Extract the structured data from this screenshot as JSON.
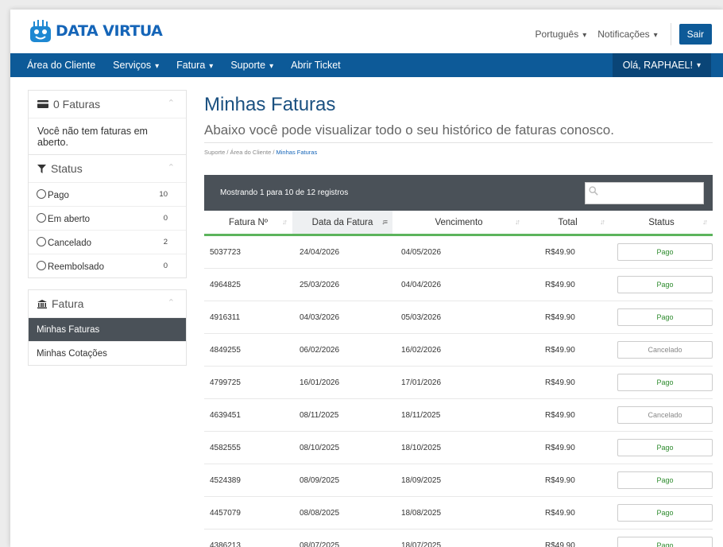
{
  "header": {
    "brand": "DATA VIRTUA",
    "language": "Português",
    "notifications": "Notificações",
    "logout": "Sair"
  },
  "navbar": {
    "items": [
      {
        "label": "Área do Cliente",
        "dropdown": false
      },
      {
        "label": "Serviços",
        "dropdown": true
      },
      {
        "label": "Fatura",
        "dropdown": true
      },
      {
        "label": "Suporte",
        "dropdown": true
      },
      {
        "label": "Abrir Ticket",
        "dropdown": false
      }
    ],
    "greeting": "Olá, RAPHAEL!"
  },
  "sidebar": {
    "invoices_panel": {
      "title": "0 Faturas",
      "message": "Você não tem faturas em aberto."
    },
    "status_panel": {
      "title": "Status",
      "items": [
        {
          "label": "Pago",
          "count": "10"
        },
        {
          "label": "Em aberto",
          "count": "0"
        },
        {
          "label": "Cancelado",
          "count": "2"
        },
        {
          "label": "Reembolsado",
          "count": "0"
        }
      ]
    },
    "fatura_panel": {
      "title": "Fatura",
      "items": [
        {
          "label": "Minhas Faturas",
          "active": true
        },
        {
          "label": "Minhas Cotações",
          "active": false
        }
      ]
    }
  },
  "main": {
    "title": "Minhas Faturas",
    "subtitle": "Abaixo você pode visualizar todo o seu histórico de faturas conosco.",
    "breadcrumb": [
      "Suporte",
      "Área do Cliente",
      "Minhas Faturas"
    ],
    "table": {
      "info": "Mostrando 1 para 10 de 12 registros",
      "search_placeholder": "",
      "columns": [
        "Fatura Nº",
        "Data da Fatura",
        "Vencimento",
        "Total",
        "Status"
      ],
      "rows": [
        {
          "id": "5037723",
          "date": "24/04/2026",
          "due": "04/05/2026",
          "total": "R$49.90",
          "status": "Pago"
        },
        {
          "id": "4964825",
          "date": "25/03/2026",
          "due": "04/04/2026",
          "total": "R$49.90",
          "status": "Pago"
        },
        {
          "id": "4916311",
          "date": "04/03/2026",
          "due": "05/03/2026",
          "total": "R$49.90",
          "status": "Pago"
        },
        {
          "id": "4849255",
          "date": "06/02/2026",
          "due": "16/02/2026",
          "total": "R$49.90",
          "status": "Cancelado"
        },
        {
          "id": "4799725",
          "date": "16/01/2026",
          "due": "17/01/2026",
          "total": "R$49.90",
          "status": "Pago"
        },
        {
          "id": "4639451",
          "date": "08/11/2025",
          "due": "18/11/2025",
          "total": "R$49.90",
          "status": "Cancelado"
        },
        {
          "id": "4582555",
          "date": "08/10/2025",
          "due": "18/10/2025",
          "total": "R$49.90",
          "status": "Pago"
        },
        {
          "id": "4524389",
          "date": "08/09/2025",
          "due": "18/09/2025",
          "total": "R$49.90",
          "status": "Pago"
        },
        {
          "id": "4457079",
          "date": "08/08/2025",
          "due": "18/08/2025",
          "total": "R$49.90",
          "status": "Pago"
        },
        {
          "id": "4386213",
          "date": "08/07/2025",
          "due": "18/07/2025",
          "total": "R$49.90",
          "status": "Pago"
        }
      ]
    }
  },
  "colors": {
    "brand": "#1565b8",
    "navbar": "#0d5a98",
    "dark_panel": "#4a5158",
    "accent_green": "#5cb45c",
    "status_paid": "#2e8b2e",
    "status_cancelled": "#888888"
  },
  "icons": {
    "logo": "robot-logo-icon",
    "invoices": "credit-card-icon",
    "status": "filter-icon",
    "fatura": "bank-icon",
    "collapse": "chevron-up-icon",
    "search": "search-icon",
    "sort": "sort-icon"
  }
}
